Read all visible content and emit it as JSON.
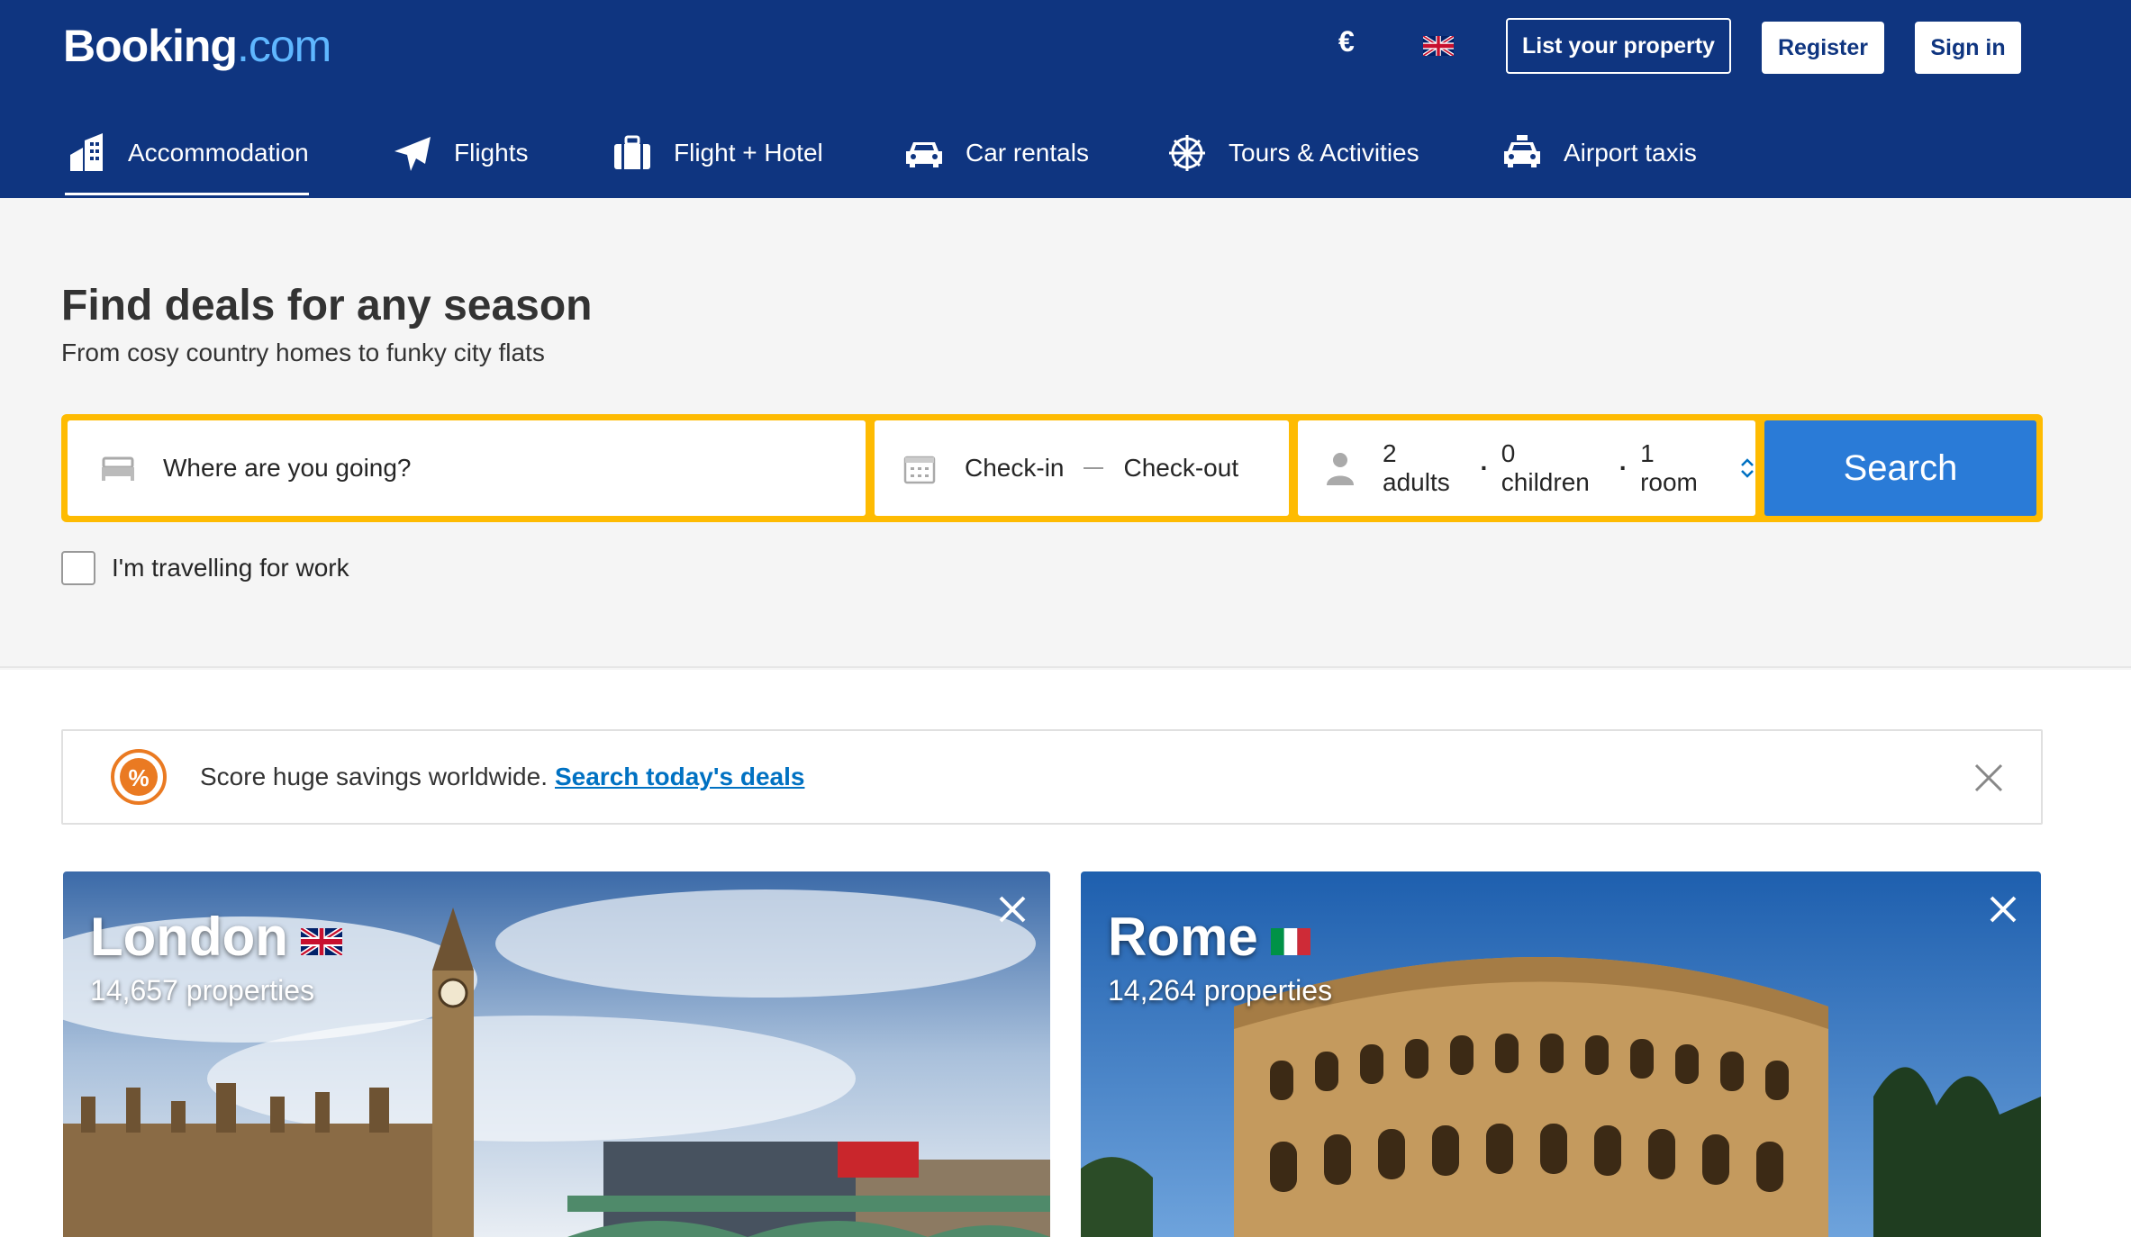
{
  "header": {
    "logo_main": "Booking",
    "logo_dot": ".com",
    "currency": "€",
    "language_icon": "uk-flag-icon",
    "list_property": "List your property",
    "register": "Register",
    "sign_in": "Sign in",
    "bg_color": "#0f3580"
  },
  "tabs": [
    {
      "label": "Accommodation",
      "icon": "hotel-icon",
      "active": true
    },
    {
      "label": "Flights",
      "icon": "plane-icon"
    },
    {
      "label": "Flight + Hotel",
      "icon": "suitcase-icon"
    },
    {
      "label": "Car rentals",
      "icon": "car-icon"
    },
    {
      "label": "Tours & Activities",
      "icon": "ferris-wheel-icon"
    },
    {
      "label": "Airport taxis",
      "icon": "taxi-icon"
    }
  ],
  "hero": {
    "title": "Find deals for any season",
    "subtitle": "From cosy country homes to funky city flats"
  },
  "search": {
    "destination_placeholder": "Where are you going?",
    "check_in": "Check-in",
    "check_out": "Check-out",
    "adults": "2 adults",
    "children": "0 children",
    "rooms": "1 room",
    "button": "Search",
    "border_color": "#febb02",
    "button_color": "#2a7bd7"
  },
  "work_checkbox": {
    "label": "I'm travelling for work",
    "checked": false
  },
  "banner": {
    "text": "Score huge savings worldwide.",
    "link": "Search today's deals"
  },
  "destinations": [
    {
      "city": "London",
      "flag": "uk-flag-icon",
      "properties": "14,657 properties"
    },
    {
      "city": "Rome",
      "flag": "italy-flag-icon",
      "properties": "14,264 properties"
    }
  ]
}
